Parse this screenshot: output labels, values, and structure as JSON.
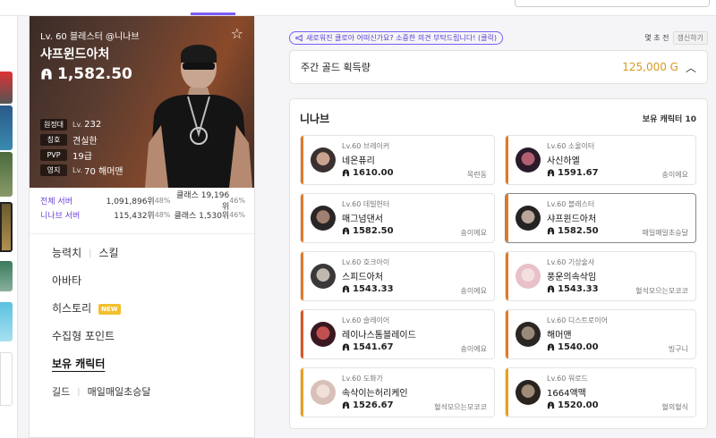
{
  "nav": {
    "fragments": [
      "",
      "",
      "",
      ""
    ],
    "search_placeholder": ""
  },
  "profile": {
    "name_line": "Lv. 60 블레스터 @니나브",
    "char_name": "샤프윈드아처",
    "power": "1,582.50",
    "stats": [
      {
        "tag": "원정대",
        "lv_prefix": "Lv.",
        "value": "232"
      },
      {
        "tag": "칭호",
        "lv_prefix": "",
        "value": "견실한"
      },
      {
        "tag": "PVP",
        "lv_prefix": "",
        "value": "19급"
      },
      {
        "tag": "영지",
        "lv_prefix": "Lv.",
        "value": "70 해머맨"
      }
    ],
    "ranks": [
      {
        "label": "전체 서버",
        "value": "1,091,896위",
        "pct1": "48%",
        "cls": "클래스 19,196위",
        "pct2": "46%"
      },
      {
        "label": "니나브 서버",
        "value": "115,432위",
        "pct1": "48%",
        "cls": "클래스 1,530위",
        "pct2": "46%"
      }
    ]
  },
  "menu": {
    "stats": "능력치",
    "skills": "스킬",
    "avatar": "아바타",
    "history": "히스토리",
    "new_badge": "NEW",
    "collect": "수집형 포인트",
    "owned": "보유 캐릭터",
    "guild_label": "길드",
    "guild_name": "매일매일초승달"
  },
  "notice": {
    "text": "새로워진 클로아 어떠신가요? 소중한 의견 부탁드립니다! (클릭)",
    "updated": "몇 초 전",
    "refresh": "갱신하기"
  },
  "gold": {
    "title": "주간 골드 획득량",
    "value": "125,000 G"
  },
  "characters": {
    "server": "니나브",
    "count_label": "보유 캐릭터 10",
    "list": [
      {
        "cls": "Lv.60 브레이커",
        "name": "네온퓨리",
        "power": "1610.00",
        "guild": "목련동",
        "stripe": "#e07b2a",
        "av": [
          "#3a3030",
          "#c9a38f"
        ]
      },
      {
        "cls": "Lv.60 소울이터",
        "name": "사신하엘",
        "power": "1591.67",
        "guild": "송이에요",
        "stripe": "#e07b2a",
        "av": [
          "#2a1a2a",
          "#b06070"
        ]
      },
      {
        "cls": "Lv.60 데빌헌터",
        "name": "매그넘댄서",
        "power": "1582.50",
        "guild": "송이에요",
        "stripe": "#e07b2a",
        "av": [
          "#2b2626",
          "#a08070"
        ]
      },
      {
        "cls": "Lv.60 블래스터",
        "name": "샤프윈드아처",
        "power": "1582.50",
        "guild": "매일매일초승달",
        "stripe": "#e07b2a",
        "av": [
          "#252222",
          "#b9a59a"
        ],
        "selected": true
      },
      {
        "cls": "Lv.60 호크아이",
        "name": "스피드아처",
        "power": "1543.33",
        "guild": "송이에요",
        "stripe": "#e07b2a",
        "av": [
          "#3a3838",
          "#c0b8b0"
        ]
      },
      {
        "cls": "Lv.60 기상술사",
        "name": "풍운의속삭임",
        "power": "1543.33",
        "guild": "혈석모으는모코코",
        "stripe": "#e07b2a",
        "av": [
          "#e8c0c8",
          "#f4dfe0"
        ]
      },
      {
        "cls": "Lv.60 슬레이어",
        "name": "레이나스톰블레이드",
        "power": "1541.67",
        "guild": "송이에요",
        "stripe": "#d9572a",
        "av": [
          "#3a1820",
          "#c05050"
        ]
      },
      {
        "cls": "Lv.60 디스트로이어",
        "name": "해머맨",
        "power": "1540.00",
        "guild": "빙구니",
        "stripe": "#e07b2a",
        "av": [
          "#2a2624",
          "#9a8a7a"
        ]
      },
      {
        "cls": "Lv.60 도화가",
        "name": "속삭이는허리케인",
        "power": "1526.67",
        "guild": "혈석모으는모코코",
        "stripe": "#e8a020",
        "av": [
          "#d8c0b8",
          "#f0e0d8"
        ]
      },
      {
        "cls": "Lv.60 워로드",
        "name": "1664액맥",
        "power": "1520.00",
        "guild": "혈의혈식",
        "stripe": "#e8a020",
        "av": [
          "#2a2420",
          "#a08a78"
        ]
      }
    ]
  }
}
